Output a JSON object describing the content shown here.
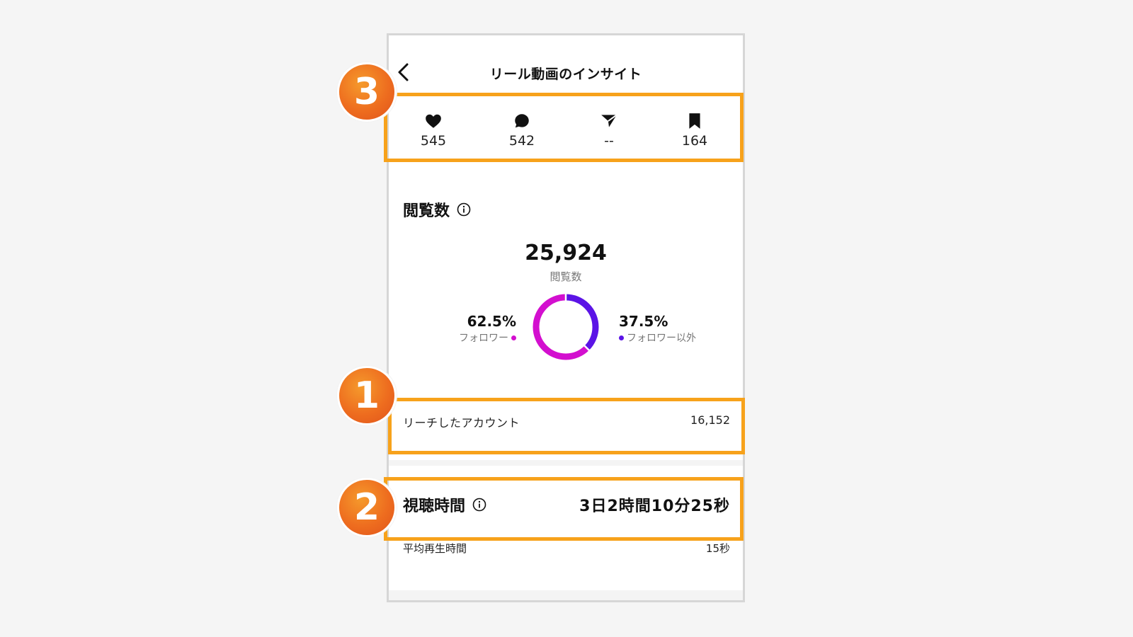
{
  "header": {
    "title": "リール動画のインサイト",
    "back_icon": "chevron-left-icon"
  },
  "engagement": [
    {
      "icon": "heart-icon",
      "value": "545"
    },
    {
      "icon": "comment-icon",
      "value": "542"
    },
    {
      "icon": "send-icon",
      "value": "--"
    },
    {
      "icon": "bookmark-icon",
      "value": "164"
    }
  ],
  "views": {
    "title": "閲覧数",
    "total": "25,924",
    "total_label": "閲覧数",
    "followers_pct": "62.5%",
    "followers_label": "フォロワー",
    "non_followers_pct": "37.5%",
    "non_followers_label": "フォロワー以外",
    "followers_fraction": 0.625,
    "non_followers_fraction": 0.375,
    "followers_color": "#d30fcf",
    "non_followers_color": "#5b14e6"
  },
  "reach": {
    "label": "リーチしたアカウント",
    "value": "16,152"
  },
  "watch_time": {
    "title": "視聴時間",
    "value": "3日2時間10分25秒"
  },
  "avg_watch": {
    "label": "平均再生時間",
    "value": "15秒"
  },
  "callouts": {
    "reach_number": "1",
    "watch_number": "2",
    "engagement_number": "3",
    "color": "#f7a21b"
  }
}
